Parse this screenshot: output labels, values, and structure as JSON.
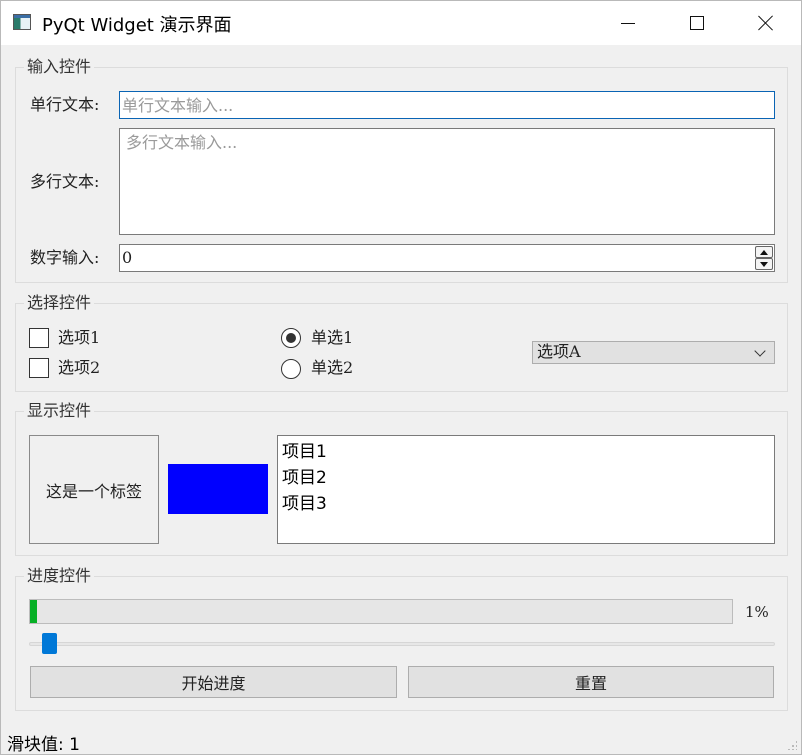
{
  "window": {
    "title": "PyQt Widget 演示界面"
  },
  "input_group": {
    "title": "输入控件",
    "single_line_label": "单行文本:",
    "single_line_placeholder": "单行文本输入...",
    "single_line_value": "",
    "multi_line_label": "多行文本:",
    "multi_line_placeholder": "多行文本输入...",
    "number_label": "数字输入:",
    "number_value": "0"
  },
  "select_group": {
    "title": "选择控件",
    "checkboxes": [
      {
        "label": "选项1",
        "checked": false
      },
      {
        "label": "选项2",
        "checked": false
      }
    ],
    "radios": [
      {
        "label": "单选1",
        "checked": true
      },
      {
        "label": "单选2",
        "checked": false
      }
    ],
    "combo_selected": "选项A"
  },
  "display_group": {
    "title": "显示控件",
    "label_text": "这是一个标签",
    "swatch_color": "#0000ff",
    "list_items": [
      "项目1",
      "项目2",
      "项目3"
    ]
  },
  "progress_group": {
    "title": "进度控件",
    "progress_value": 1,
    "progress_text": "1%",
    "slider_value": 1,
    "slider_max": 100,
    "start_button": "开始进度",
    "reset_button": "重置"
  },
  "status": {
    "text": "滑块值: 1"
  },
  "colors": {
    "progress_fill": "#06b025",
    "slider_handle": "#0078d7",
    "focus_border": "#0a64b4"
  }
}
